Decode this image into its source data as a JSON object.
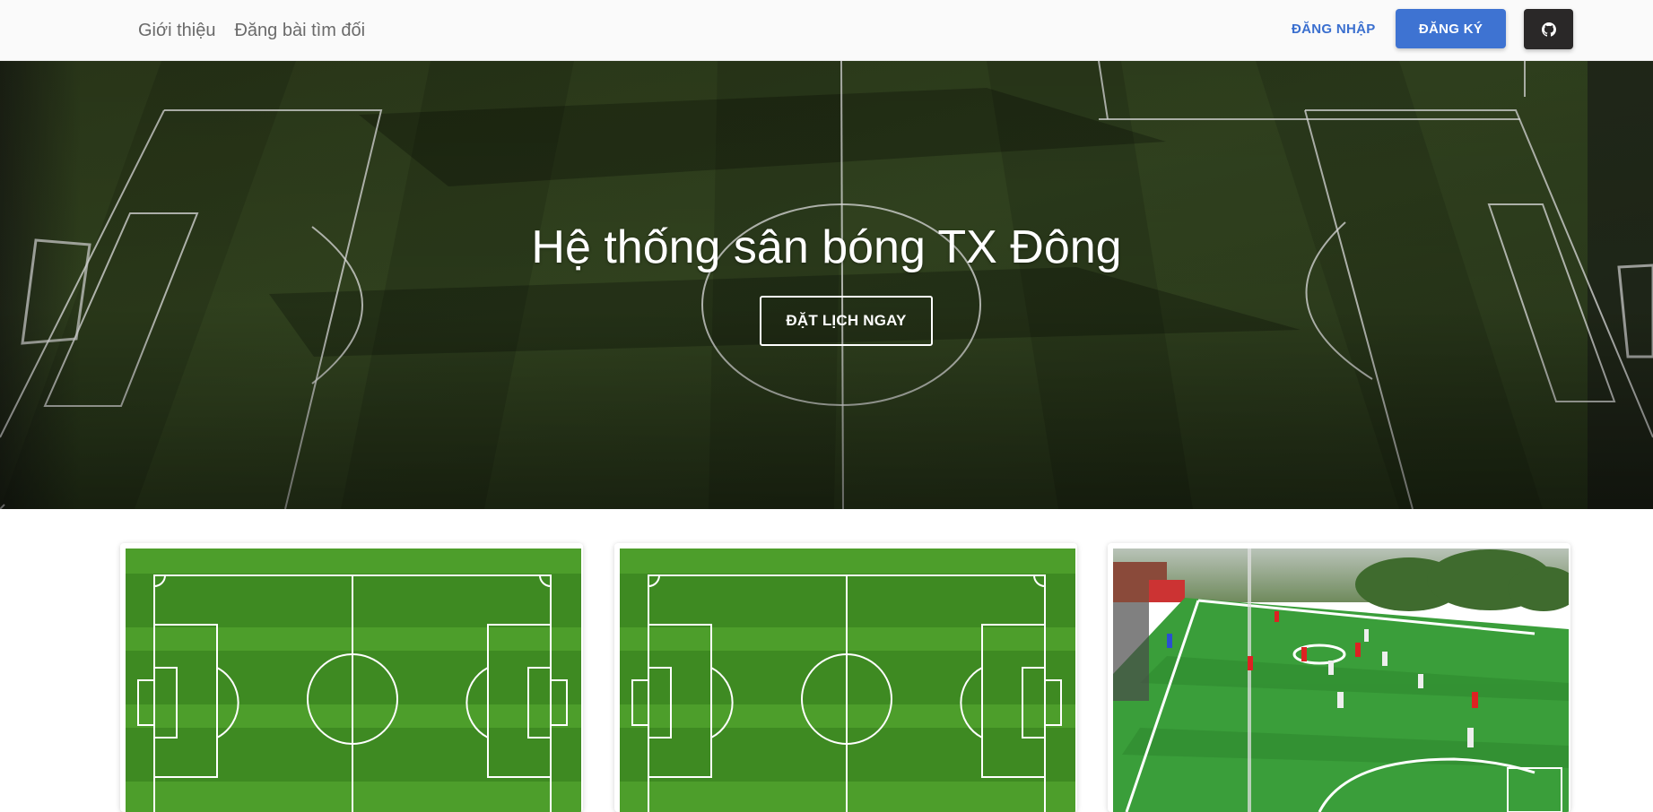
{
  "navbar": {
    "links": [
      {
        "label": "Giới thiệu"
      },
      {
        "label": "Đăng bài tìm đối"
      }
    ],
    "login_label": "ĐĂNG NHẬP",
    "register_label": "ĐĂNG KÝ",
    "github_icon": "github-icon"
  },
  "hero": {
    "title": "Hệ thống sân bóng TX Đông",
    "cta_label": "ĐẶT LỊCH NGAY",
    "background": "aerial-football-pitch-photo"
  },
  "cards": [
    {
      "image": "football-pitch-diagram"
    },
    {
      "image": "football-pitch-diagram"
    },
    {
      "image": "mini-football-match-photo"
    }
  ],
  "colors": {
    "primary": "#3e73d2",
    "login_text": "#3a6fcf",
    "github_bg": "#2a2828",
    "navbar_bg": "#fafafa"
  }
}
